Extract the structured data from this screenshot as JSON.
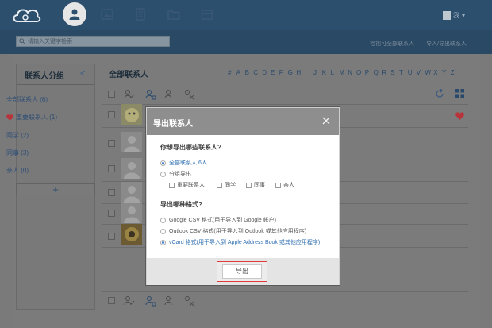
{
  "topbar": {
    "user_label": "我",
    "colors": {
      "bar": "#2d4f6e",
      "active_tab": "#e6e6e6"
    }
  },
  "search": {
    "placeholder": "请输入关键字检索"
  },
  "top_links": {
    "view_all": "检视可全部联系人",
    "import_export": "导入/导出联系人"
  },
  "sidebar": {
    "title": "联系人分组",
    "groups": [
      {
        "label": "全部联系人 (6)"
      },
      {
        "label": "重要联系人 (1)"
      },
      {
        "label": "同学 (2)"
      },
      {
        "label": "同事 (3)"
      },
      {
        "label": "亲人 (0)"
      }
    ],
    "add_label": "+"
  },
  "contacts": {
    "title": "全部联系人",
    "alphabet": [
      "#",
      "A",
      "B",
      "C",
      "D",
      "E",
      "F",
      "G",
      "H",
      "I",
      "J",
      "K",
      "L",
      "M",
      "N",
      "O",
      "P",
      "Q",
      "R",
      "S",
      "T",
      "U",
      "V",
      "W",
      "X",
      "Y",
      "Z"
    ]
  },
  "modal": {
    "title": "导出联系人",
    "q1": "你想导出哪些联系人?",
    "opt_all": "全部联系人  6人",
    "opt_group": "分组导出",
    "groups": [
      "重要联系人",
      "同学",
      "同事",
      "亲人"
    ],
    "q2": "导出哪种格式?",
    "formats": [
      "Google CSV 格式(用于导入到 Google 帐户)",
      "Outlook CSV 格式(用于导入到 Outlook 或其他应用程序)",
      "vCard 格式(用于导入到 Apple Address Book 或其他应用程序)"
    ],
    "export_label": "导出",
    "colors": {
      "highlight": "#e23b3b",
      "selected": "#2f6fb1"
    }
  }
}
